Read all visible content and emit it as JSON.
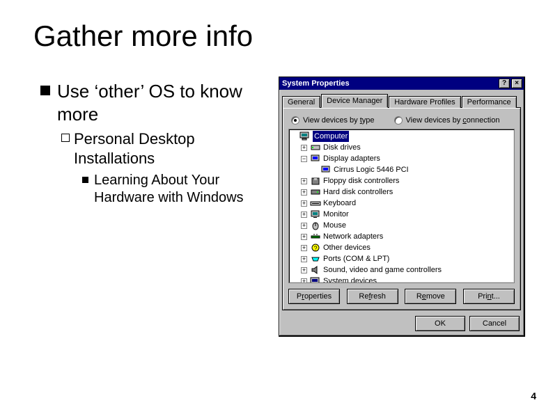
{
  "slide": {
    "title": "Gather more info",
    "b1": "Use ‘other’ OS to know more",
    "b2": "Personal Desktop Installations",
    "b3": "Learning About Your Hardware with Windows",
    "page_number": "4"
  },
  "dialog": {
    "title": "System Properties",
    "help_btn": "?",
    "close_btn": "×",
    "tabs": {
      "general": "General",
      "device_manager": "Device Manager",
      "hardware_profiles": "Hardware Profiles",
      "performance": "Performance"
    },
    "radio": {
      "by_type": "View devices by ",
      "by_type_u": "t",
      "by_type_suffix": "ype",
      "by_conn": "View devices by ",
      "by_conn_u": "c",
      "by_conn_suffix": "onnection"
    },
    "tree": {
      "root": "Computer",
      "items": [
        {
          "label": "Disk drives",
          "icon": "disk"
        },
        {
          "label": "Display adapters",
          "icon": "display",
          "expanded": true,
          "children": [
            {
              "label": "Cirrus Logic 5446 PCI",
              "icon": "display"
            }
          ]
        },
        {
          "label": "Floppy disk controllers",
          "icon": "floppy"
        },
        {
          "label": "Hard disk controllers",
          "icon": "hdc"
        },
        {
          "label": "Keyboard",
          "icon": "keyboard"
        },
        {
          "label": "Monitor",
          "icon": "monitor"
        },
        {
          "label": "Mouse",
          "icon": "mouse"
        },
        {
          "label": "Network adapters",
          "icon": "network"
        },
        {
          "label": "Other devices",
          "icon": "other"
        },
        {
          "label": "Ports (COM & LPT)",
          "icon": "ports"
        },
        {
          "label": "Sound, video and game controllers",
          "icon": "sound"
        },
        {
          "label": "System devices",
          "icon": "system"
        }
      ]
    },
    "buttons": {
      "properties_pre": "P",
      "properties_u": "r",
      "properties_suf": "operties",
      "refresh_pre": "Re",
      "refresh_u": "f",
      "refresh_suf": "resh",
      "remove_pre": "R",
      "remove_u": "e",
      "remove_suf": "move",
      "print_pre": "Pri",
      "print_u": "n",
      "print_suf": "t...",
      "ok": "OK",
      "cancel": "Cancel"
    }
  }
}
